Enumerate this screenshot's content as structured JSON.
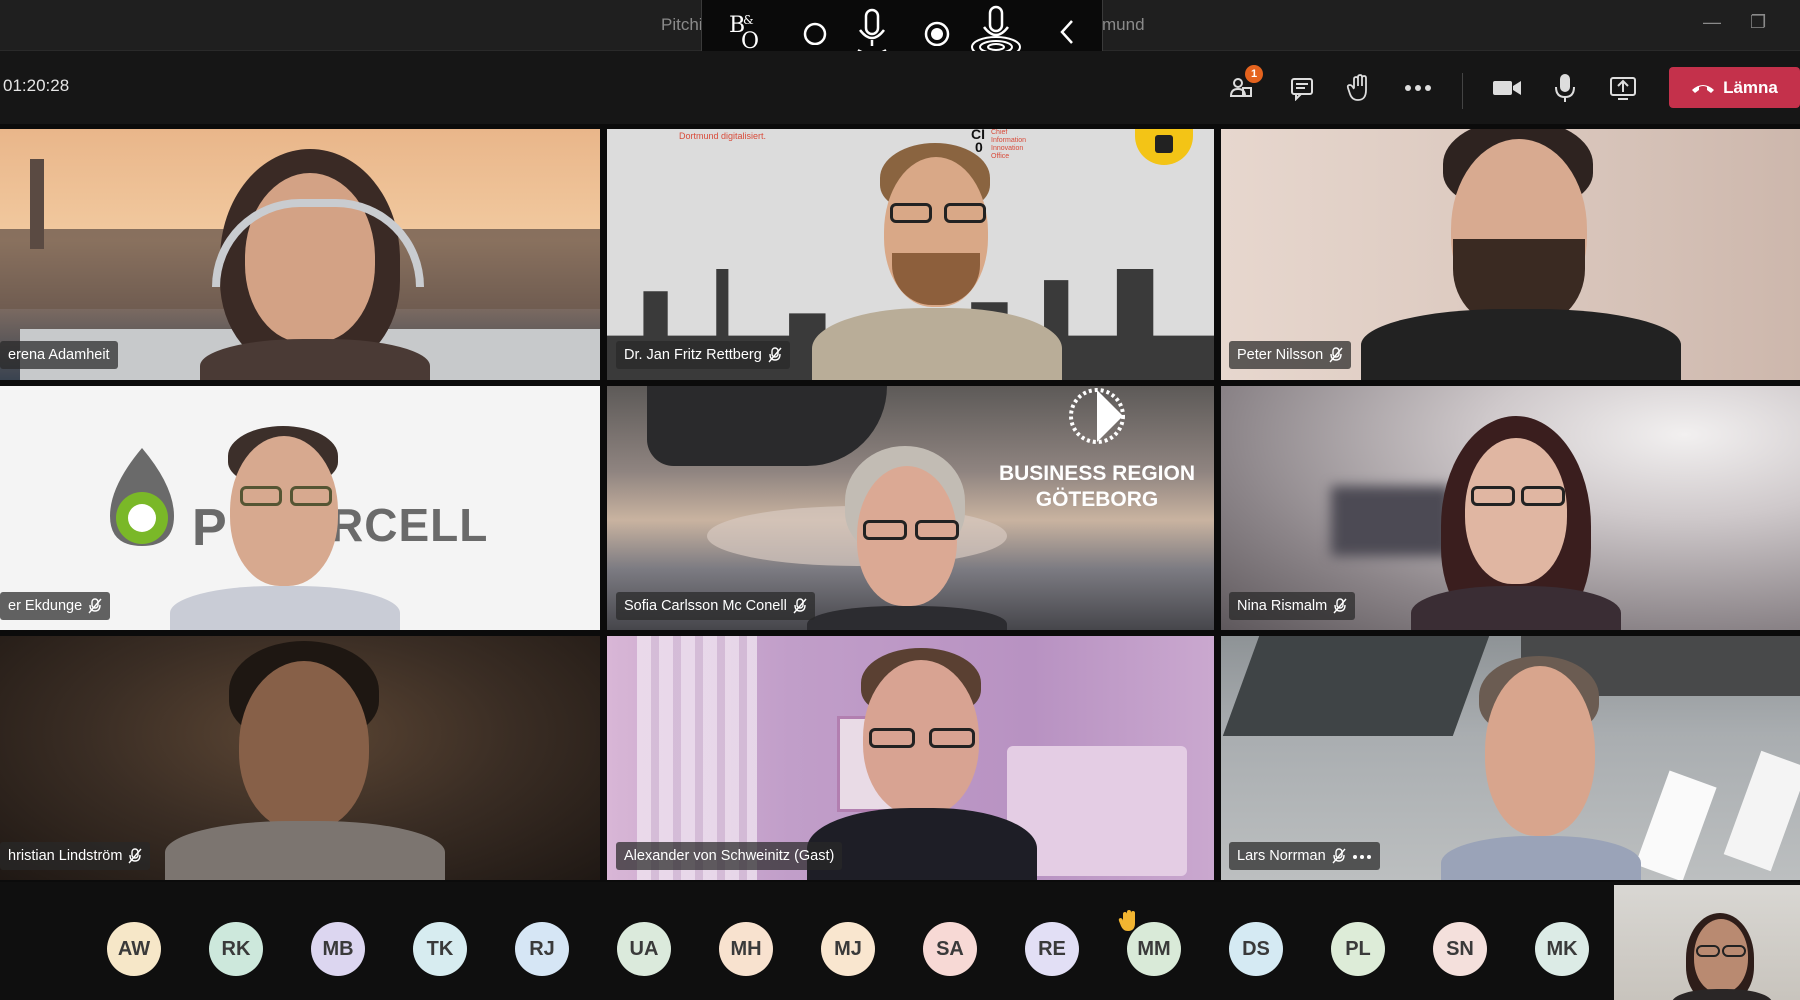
{
  "window": {
    "title_left": "Pitchi",
    "title_right": "mund",
    "minimize": "—",
    "restore": "❐"
  },
  "overlay_icons": [
    "bang-olufsen-logo",
    "circle-icon",
    "microphone-icon",
    "record-icon",
    "microphone-active-icon",
    "chevron-left-icon"
  ],
  "meeting": {
    "timer": "01:20:28",
    "participants_badge": "1",
    "leave_label": "Lämna"
  },
  "tiles": [
    {
      "name": "erena Adamheit",
      "muted": false
    },
    {
      "name": "Dr. Jan Fritz Rettberg",
      "muted": true
    },
    {
      "name": "Peter Nilsson",
      "muted": true
    },
    {
      "name": "er Ekdunge",
      "muted": true
    },
    {
      "name": "Sofia Carlsson Mc Conell",
      "muted": true
    },
    {
      "name": "Nina Rismalm",
      "muted": true
    },
    {
      "name": "hristian Lindström",
      "muted": true
    },
    {
      "name": "Alexander von Schweinitz (Gast)",
      "muted": false
    },
    {
      "name": "Lars Norrman",
      "muted": true
    }
  ],
  "backgrounds": {
    "dortmund_caption": "Dortmund digitalisiert.",
    "cio_line1": "CI",
    "cio_line2": "0",
    "cio_text": "Chief\nInformation\nInnovation\nOffice",
    "powercell_left": "P",
    "powercell_right": "RCELL",
    "business_region_line1": "BUSINESS REGION",
    "business_region_line2": "GÖTEBORG"
  },
  "avatars": [
    {
      "initials": "AW",
      "color": "#f6e7c8"
    },
    {
      "initials": "RK",
      "color": "#cde8dc"
    },
    {
      "initials": "MB",
      "color": "#dcd6f0"
    },
    {
      "initials": "TK",
      "color": "#d7ecf0"
    },
    {
      "initials": "RJ",
      "color": "#d6e6f5"
    },
    {
      "initials": "UA",
      "color": "#dbeadc"
    },
    {
      "initials": "MH",
      "color": "#f8e2cf"
    },
    {
      "initials": "MJ",
      "color": "#f9e6cf"
    },
    {
      "initials": "SA",
      "color": "#f7d9d5"
    },
    {
      "initials": "RE",
      "color": "#e2dff5"
    },
    {
      "initials": "MM",
      "color": "#d9ead8"
    },
    {
      "initials": "DS",
      "color": "#d5eaf3"
    },
    {
      "initials": "PL",
      "color": "#ddecd8"
    },
    {
      "initials": "SN",
      "color": "#f4e0dc"
    },
    {
      "initials": "MK",
      "color": "#dcebe6"
    }
  ],
  "raised_hand_on": "MM",
  "colors": {
    "leave_button": "#c4314b",
    "badge": "#e5631e",
    "raised_hand": "#f2b531"
  }
}
